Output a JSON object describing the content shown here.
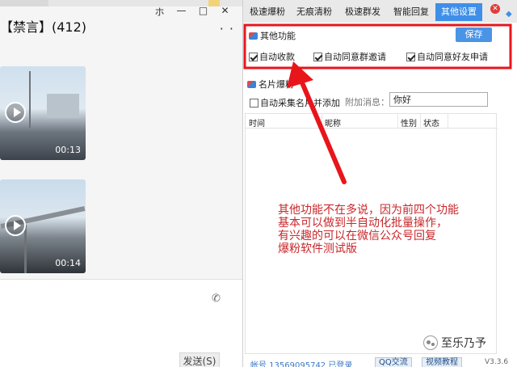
{
  "chat": {
    "title": "【禁言】(412)",
    "window_buttons": [
      "ホ",
      "—",
      "□",
      "✕"
    ],
    "more": "· ·",
    "videos": [
      {
        "duration": "00:13"
      },
      {
        "duration": "00:14"
      }
    ],
    "send_label": "发送(S)"
  },
  "tabs": [
    {
      "label": "极速爆粉",
      "active": false
    },
    {
      "label": "无痕清粉",
      "active": false
    },
    {
      "label": "极速群发",
      "active": false
    },
    {
      "label": "智能回复",
      "active": false
    },
    {
      "label": "其他设置",
      "active": true
    }
  ],
  "other_functions": {
    "title": "其他功能",
    "save_label": "保存",
    "options": [
      {
        "label": "自动收款",
        "checked": true
      },
      {
        "label": "自动同意群邀请",
        "checked": true
      },
      {
        "label": "自动同意好友申请",
        "checked": true
      }
    ]
  },
  "card_boost": {
    "title": "名片爆粉",
    "collect_label": "自动采集名片并添加",
    "collect_checked": false,
    "message_label": "附加消息：",
    "message_value": "你好"
  },
  "table": {
    "columns": [
      "时间",
      "昵称",
      "性别",
      "状态"
    ]
  },
  "annotation": {
    "lines": [
      "其他功能不在多说，因为前四个功能",
      "基本可以做到半自动化批量操作，",
      "有兴趣的可以在微信公众号回复",
      "爆粉软件测试版"
    ],
    "color": "#c8272b"
  },
  "status_bar": {
    "left_text": "帐号 13569095742 已登录",
    "qq_label": "QQ交流",
    "video_label": "视频教程",
    "version": "V3.3.6"
  },
  "watermark": {
    "text": "至乐乃予"
  },
  "colors": {
    "accent": "#3f8fe8",
    "highlight_border": "#e8151b",
    "arrow": "#e8151b"
  }
}
